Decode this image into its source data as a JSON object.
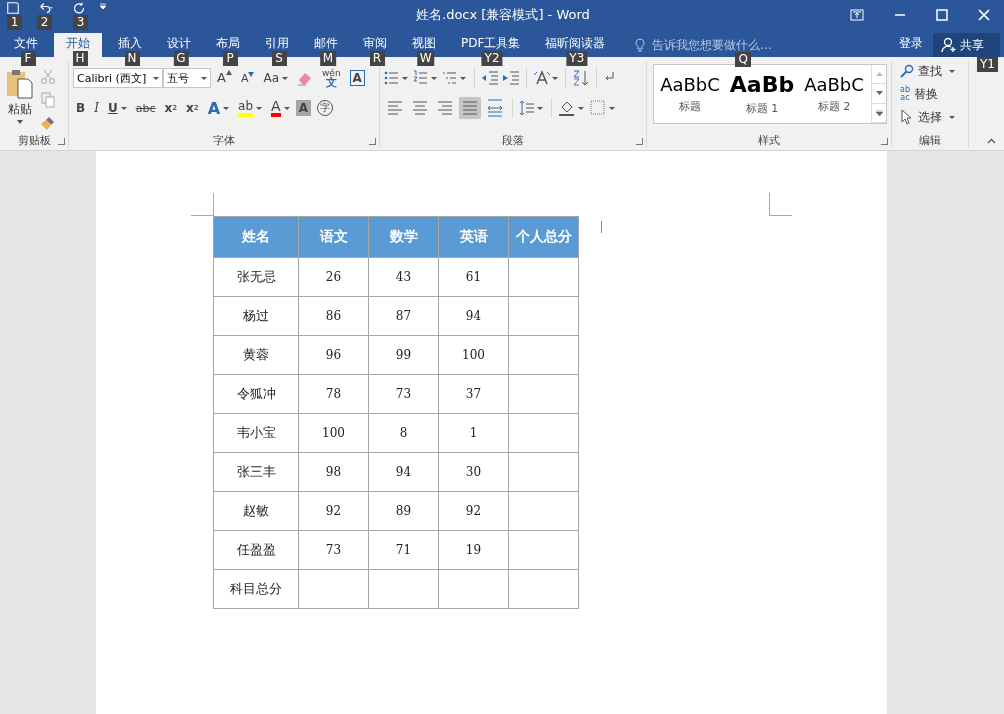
{
  "quick_access": [
    {
      "kind": "save",
      "keytip": "1"
    },
    {
      "kind": "undo",
      "keytip": "2"
    },
    {
      "kind": "redo",
      "keytip": "3"
    }
  ],
  "window": {
    "title": "姓名.docx [兼容模式] - Word"
  },
  "tabs": [
    {
      "label": "文件",
      "keytip": "F",
      "selected": false
    },
    {
      "label": "开始",
      "keytip": "H",
      "selected": true
    },
    {
      "label": "插入",
      "keytip": "N",
      "selected": false
    },
    {
      "label": "设计",
      "keytip": "G",
      "selected": false
    },
    {
      "label": "布局",
      "keytip": "P",
      "selected": false
    },
    {
      "label": "引用",
      "keytip": "S",
      "selected": false
    },
    {
      "label": "邮件",
      "keytip": "M",
      "selected": false
    },
    {
      "label": "审阅",
      "keytip": "R",
      "selected": false
    },
    {
      "label": "视图",
      "keytip": "W",
      "selected": false
    },
    {
      "label": "PDF工具集",
      "keytip": "Y2",
      "selected": false
    },
    {
      "label": "福昕阅读器",
      "keytip": "Y3",
      "selected": false
    }
  ],
  "tell_me": {
    "placeholder": "告诉我您想要做什么...",
    "keytip": "Q"
  },
  "sign_in": "登录",
  "share": {
    "label": "共享",
    "keytip": "Y1"
  },
  "clipboard": {
    "label": "剪贴板",
    "paste": "粘贴"
  },
  "font": {
    "label": "字体",
    "font_name": "Calibri (西文]",
    "font_size": "五号",
    "row1": [
      {
        "kind": "grow",
        "label": "A"
      },
      {
        "kind": "shrink",
        "label": "A"
      },
      {
        "kind": "case",
        "label": "Aa"
      },
      {
        "kind": "clear"
      },
      {
        "kind": "phonetic",
        "label": "wén",
        "sub": "文"
      },
      {
        "kind": "border",
        "label": "A"
      }
    ],
    "row2": [
      {
        "kind": "bold",
        "label": "B"
      },
      {
        "kind": "italic",
        "label": "I"
      },
      {
        "kind": "underline",
        "label": "U"
      },
      {
        "kind": "strike",
        "label": "abc"
      },
      {
        "kind": "subscript",
        "label": "x",
        "sub": "2"
      },
      {
        "kind": "superscript",
        "label": "x",
        "sub": "2"
      },
      {
        "kind": "effects",
        "label": "A"
      },
      {
        "kind": "highlight",
        "label": "ab"
      },
      {
        "kind": "color",
        "label": "A"
      },
      {
        "kind": "shading",
        "label": "A"
      },
      {
        "kind": "enclose",
        "label": "字"
      }
    ]
  },
  "paragraph": {
    "label": "段落",
    "alignment": [
      {
        "selected": false
      },
      {
        "selected": false
      },
      {
        "selected": false
      },
      {
        "selected": true
      },
      {
        "selected": false
      }
    ]
  },
  "styles": {
    "label": "样式",
    "items": [
      {
        "preview": "AaBbC",
        "name": "标题",
        "kind": "title"
      },
      {
        "preview": "AaBb",
        "name": "标题 1",
        "kind": "h1"
      },
      {
        "preview": "AaBbC",
        "name": "标题 2",
        "kind": "h2"
      }
    ]
  },
  "editing": {
    "label": "编辑",
    "items": [
      {
        "kind": "find",
        "label": "查找"
      },
      {
        "kind": "replace",
        "label": "替换",
        "glyph": "ab",
        "glyph2": "ac"
      },
      {
        "kind": "select",
        "label": "选择"
      }
    ]
  },
  "table": {
    "columns": [
      "姓名",
      "语文",
      "数学",
      "英语",
      "个人总分"
    ],
    "rows": [
      [
        "张无忌",
        "26",
        "43",
        "61",
        ""
      ],
      [
        "杨过",
        "86",
        "87",
        "94",
        ""
      ],
      [
        "黄蓉",
        "96",
        "99",
        "100",
        ""
      ],
      [
        "令狐冲",
        "78",
        "73",
        "37",
        ""
      ],
      [
        "韦小宝",
        "100",
        "8",
        "1",
        ""
      ],
      [
        "张三丰",
        "98",
        "94",
        "30",
        ""
      ],
      [
        "赵敏",
        "92",
        "89",
        "92",
        ""
      ],
      [
        "任盈盈",
        "73",
        "71",
        "19",
        ""
      ],
      [
        "科目总分",
        "",
        "",
        "",
        ""
      ]
    ]
  }
}
